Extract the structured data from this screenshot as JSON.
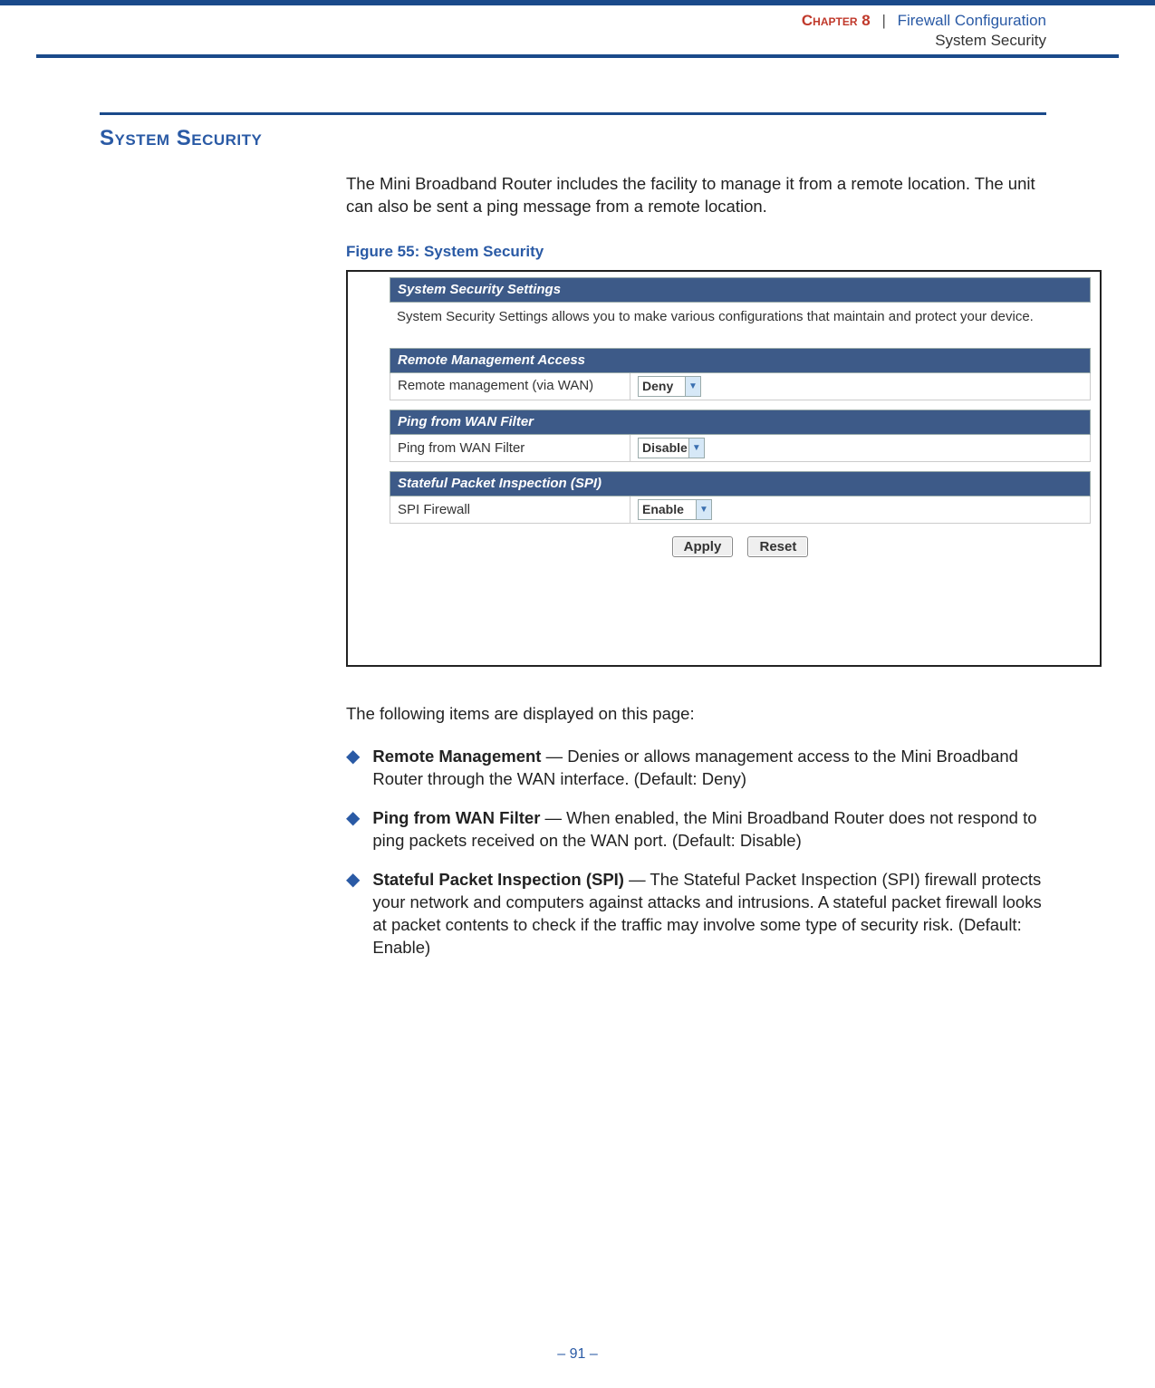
{
  "header": {
    "chapter_label": "Chapter 8",
    "separator": "|",
    "chapter_title": "Firewall Configuration",
    "section_label": "System Security"
  },
  "section": {
    "heading": "System Security",
    "intro": "The Mini Broadband Router includes the facility to manage it from a remote location. The unit can also be sent a ping message from a remote location.",
    "figure_caption": "Figure 55:  System Security"
  },
  "router_ui": {
    "panel1": {
      "title": "System Security Settings",
      "desc": "System Security Settings allows you to make various configurations that maintain and protect your device."
    },
    "panel2": {
      "title": "Remote Management Access",
      "row_label": "Remote management (via WAN)",
      "select_value": "Deny"
    },
    "panel3": {
      "title": "Ping from WAN Filter",
      "row_label": "Ping from WAN Filter",
      "select_value": "Disable"
    },
    "panel4": {
      "title": "Stateful Packet Inspection (SPI)",
      "row_label": "SPI Firewall",
      "select_value": "Enable"
    },
    "apply_label": "Apply",
    "reset_label": "Reset"
  },
  "items_lead": "The following items are displayed on this page:",
  "bullets": [
    {
      "bold": "Remote Management",
      "rest": " — Denies or allows management access to the Mini Broadband Router through the WAN interface. (Default: Deny)"
    },
    {
      "bold": "Ping from WAN Filter",
      "rest": " — When enabled, the Mini Broadband Router does not respond to ping packets received on the WAN port. (Default: Disable)"
    },
    {
      "bold": "Stateful Packet Inspection (SPI)",
      "rest": " — The Stateful Packet Inspection (SPI) firewall protects your network and computers against attacks and intrusions. A stateful packet firewall looks at packet contents to check if the traffic may involve some type of security risk. (Default: Enable)"
    }
  ],
  "footer": "–  91  –"
}
